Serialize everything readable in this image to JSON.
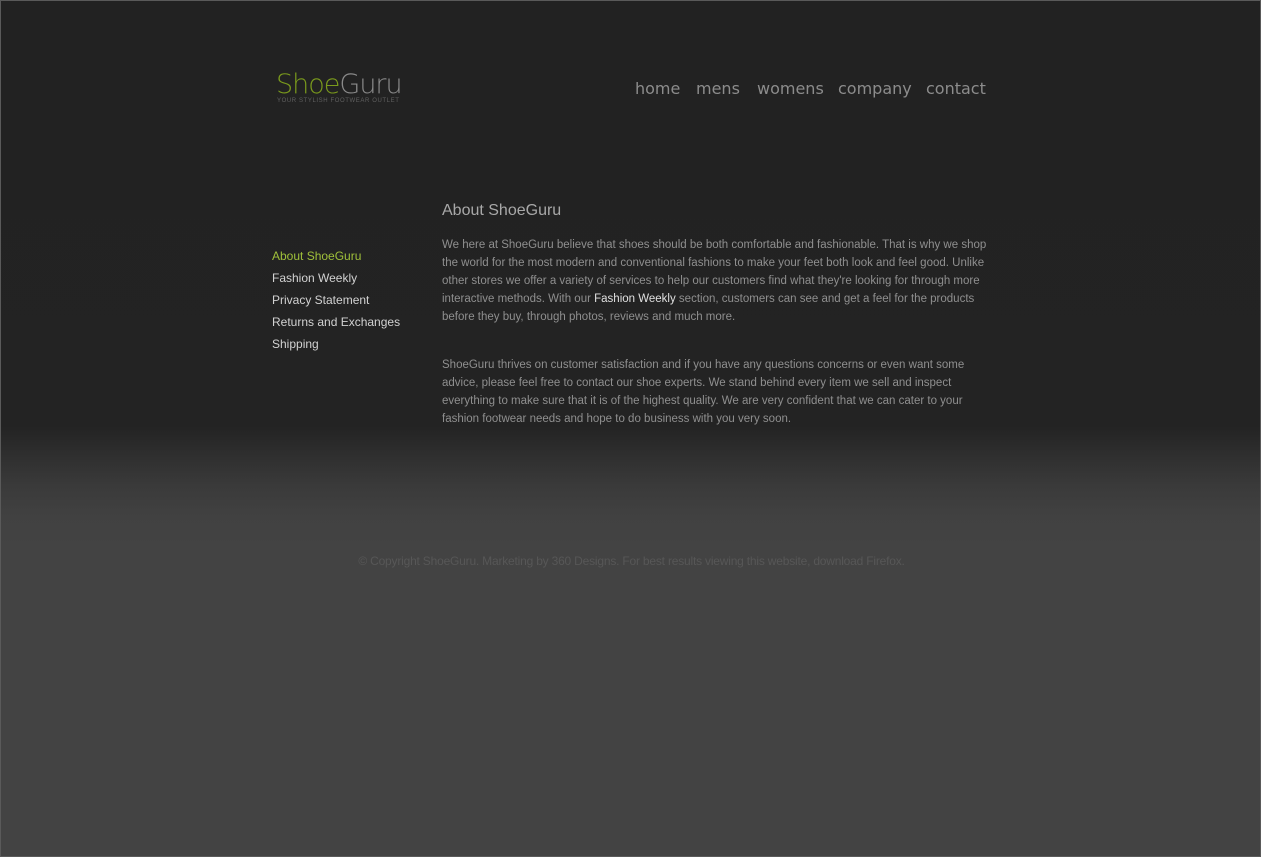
{
  "brand": {
    "name_part1": "Shoe",
    "name_part2": "Guru",
    "tagline": "YOUR STYLISH FOOTWEAR OUTLET",
    "colors": {
      "shoe": "#7a9a1c",
      "guru": "#8a8a8a"
    }
  },
  "nav": {
    "items": [
      {
        "label": "home"
      },
      {
        "label": "mens"
      },
      {
        "label": "womens"
      },
      {
        "label": "company"
      },
      {
        "label": "contact"
      }
    ]
  },
  "sidebar": {
    "items": [
      {
        "label": "About ShoeGuru",
        "active": true
      },
      {
        "label": "Fashion Weekly"
      },
      {
        "label": "Privacy Statement"
      },
      {
        "label": "Returns and Exchanges"
      },
      {
        "label": "Shipping"
      }
    ],
    "active_color": "#9fc03a"
  },
  "content": {
    "heading": "About ShoeGuru",
    "paragraph1_before": "We here at ShoeGuru believe that shoes should be both comfortable and fashionable. That is why we shop the world for the most modern and conventional fashions to make your feet both look and feel good. Unlike other stores we offer a variety of services to help our customers find what they're looking for through more interactive methods. With our ",
    "paragraph1_link": "Fashion Weekly",
    "paragraph1_after": " section, customers can see and get a feel for the products before they buy, through photos, reviews and much more.",
    "paragraph2": "ShoeGuru thrives on customer satisfaction and if you have any questions concerns or even want some advice, please feel free to contact our shoe experts. We stand behind every item we sell and inspect everything to make sure that it is of the highest quality. We are very confident that we can cater to your fashion footwear needs and hope to do business with you very soon."
  },
  "footer": {
    "text": "© Copyright ShoeGuru. Marketing by 360 Designs. For best results viewing this website, download Firefox."
  }
}
